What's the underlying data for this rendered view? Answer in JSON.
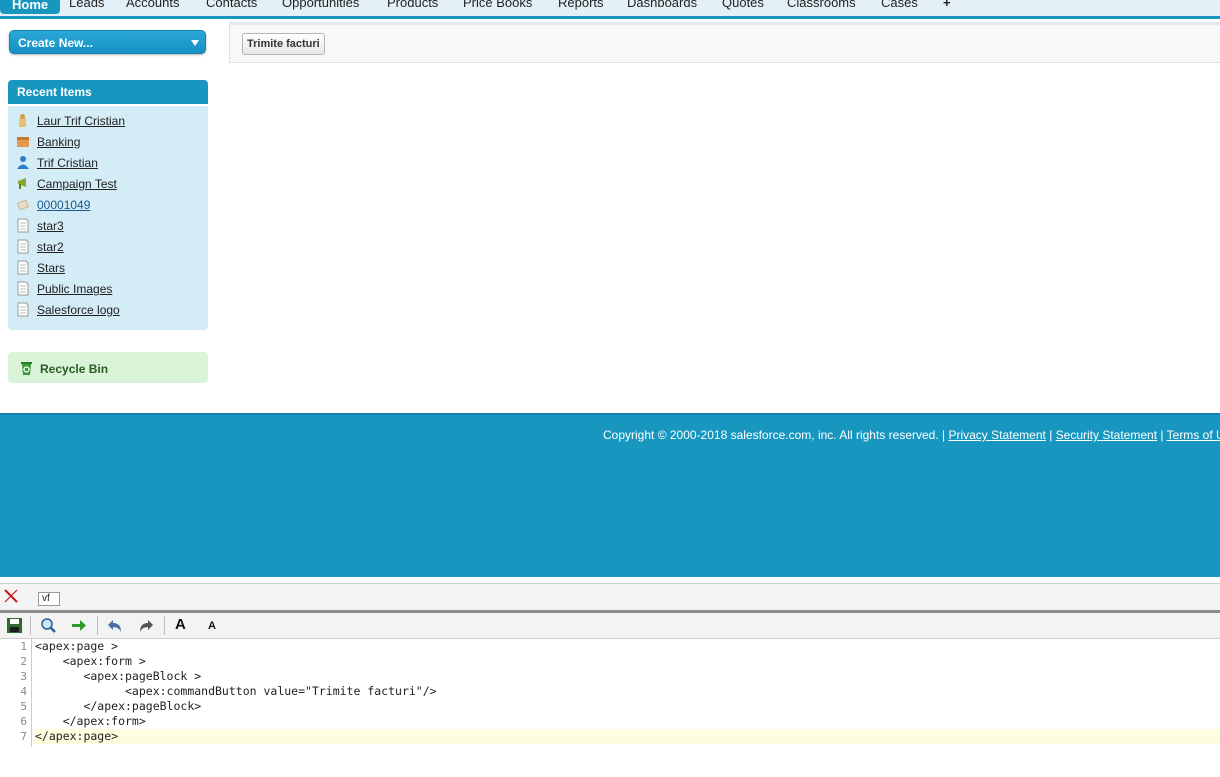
{
  "tabs": [
    {
      "label": "Home",
      "active": true
    },
    {
      "label": "Leads"
    },
    {
      "label": "Accounts"
    },
    {
      "label": "Contacts"
    },
    {
      "label": "Opportunities"
    },
    {
      "label": "Products"
    },
    {
      "label": "Price Books"
    },
    {
      "label": "Reports"
    },
    {
      "label": "Dashboards"
    },
    {
      "label": "Quotes"
    },
    {
      "label": "Classrooms"
    },
    {
      "label": "Cases"
    },
    {
      "label": "+"
    }
  ],
  "sidebar": {
    "create_new": "Create New...",
    "recent_title": "Recent Items",
    "recent_items": [
      {
        "label": "Laur Trif Cristian",
        "icon": "lead-icon"
      },
      {
        "label": "Banking",
        "icon": "account-icon"
      },
      {
        "label": "Trif Cristian",
        "icon": "contact-icon"
      },
      {
        "label": "Campaign Test",
        "icon": "campaign-icon"
      },
      {
        "label": "00001049",
        "icon": "case-icon"
      },
      {
        "label": "star3",
        "icon": "document-icon"
      },
      {
        "label": "star2",
        "icon": "document-icon"
      },
      {
        "label": "Stars",
        "icon": "document-icon"
      },
      {
        "label": "Public Images",
        "icon": "document-icon"
      },
      {
        "label": "Salesforce logo",
        "icon": "document-icon"
      }
    ],
    "recycle_bin": "Recycle Bin"
  },
  "main": {
    "command_button": "Trimite facturi"
  },
  "footer": {
    "copyright": "Copyright © 2000-2018 salesforce.com, inc. All rights reserved. |",
    "sep": "|",
    "links": [
      "Privacy Statement",
      "Security Statement",
      "Terms of U"
    ]
  },
  "devbar": {
    "page_name": "vf"
  },
  "editor": {
    "lines": [
      {
        "num": "1",
        "code": "<apex:page >"
      },
      {
        "num": "2",
        "code": "    <apex:form >"
      },
      {
        "num": "3",
        "code": "       <apex:pageBlock >"
      },
      {
        "num": "4",
        "code": "             <apex:commandButton value=\"Trimite facturi\"/>"
      },
      {
        "num": "5",
        "code": "       </apex:pageBlock>"
      },
      {
        "num": "6",
        "code": "    </apex:form>"
      },
      {
        "num": "7",
        "code": "</apex:page>"
      }
    ]
  },
  "colors": {
    "brand": "#1797c0",
    "recent_bg": "#d4ecf6",
    "recycle_bg": "#d9f4d9"
  }
}
